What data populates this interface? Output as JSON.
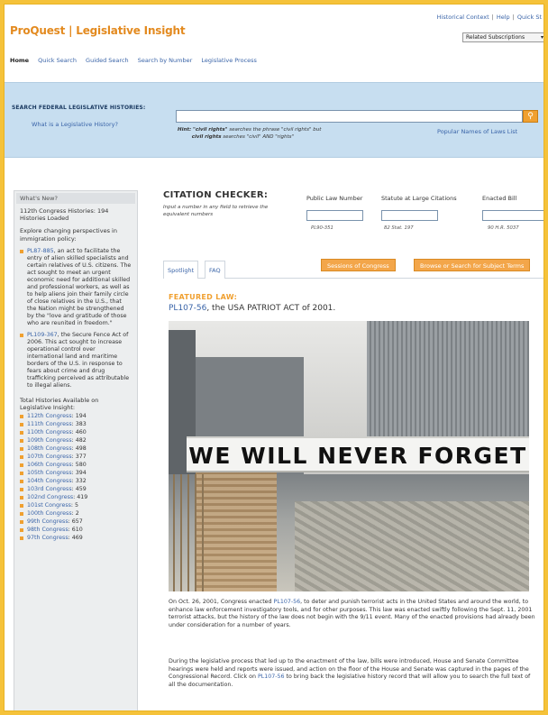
{
  "header": {
    "brand": "ProQuest | Legislative Insight",
    "top_links": [
      "Historical Context",
      "Help",
      "Quick St"
    ],
    "related_select": "Related Subscriptions"
  },
  "nav": {
    "items": [
      "Home",
      "Quick Search",
      "Guided Search",
      "Search by Number",
      "Legislative Process"
    ]
  },
  "search": {
    "label": "SEARCH FEDERAL LEGISLATIVE HISTORIES:",
    "what_link": "What is a Legislative History?",
    "input_value": "",
    "hint_prefix": "Hint:",
    "hint_phrase1": "\"civil rights\"",
    "hint_text1": "searches the phrase \"civil rights\" but",
    "hint_phrase2": "civil rights",
    "hint_text2": "searches \"civil\" AND \"rights\"",
    "popular_link": "Popular Names of Laws List",
    "button_icon": "search-icon"
  },
  "sidebar": {
    "heading": "What's New?",
    "loaded_text": "112th Congress Histories: 194 Histories Loaded",
    "explore_text": "Explore changing perspectives in immigration policy:",
    "items": [
      {
        "link": "PL87-885",
        "text": ", an act to facilitate the entry of alien skilled specialists and certain relatives of U.S. citizens. The act sought to meet an urgent economic need for additional skilled and professional workers, as well as to help aliens join their family circle of close relatives in the U.S., that the Nation might be strengthened by the \"love and gratitude of those who are reunited in freedom.\""
      },
      {
        "link": "PL109-367",
        "text": ", the Secure Fence Act of 2006. This act sought to increase operational control over international land and maritime borders of the U.S. in response to fears about crime and drug trafficking perceived as attributable to illegal aliens."
      }
    ],
    "total_heading": "Total Histories Available on Legislative Insight:",
    "congresses": [
      {
        "name": "112th Congress",
        "count": "194"
      },
      {
        "name": "111th Congress",
        "count": "383"
      },
      {
        "name": "110th Congress",
        "count": "460"
      },
      {
        "name": "109th Congress",
        "count": "482"
      },
      {
        "name": "108th Congress",
        "count": "498"
      },
      {
        "name": "107th Congress",
        "count": "377"
      },
      {
        "name": "106th Congress",
        "count": "580"
      },
      {
        "name": "105th Congress",
        "count": "394"
      },
      {
        "name": "104th Congress",
        "count": "332"
      },
      {
        "name": "103rd Congress",
        "count": "459"
      },
      {
        "name": "102nd Congress",
        "count": "419"
      },
      {
        "name": "101st Congress",
        "count": "5"
      },
      {
        "name": "100th Congress",
        "count": "2"
      },
      {
        "name": "99th Congress",
        "count": "657"
      },
      {
        "name": "98th Congress",
        "count": "610"
      },
      {
        "name": "97th Congress",
        "count": "469"
      }
    ]
  },
  "citation": {
    "title": "CITATION CHECKER:",
    "desc": "Input a number in any field to retrieve the equivalent numbers",
    "columns": [
      {
        "label": "Public Law Number",
        "example": "PL90-351"
      },
      {
        "label": "Statute at Large Citations",
        "example": "82 Stat. 197"
      },
      {
        "label": "Enacted Bill",
        "example": "90 H.R. 5037"
      }
    ]
  },
  "tabs": {
    "spotlight": "Spotlight",
    "faq": "FAQ",
    "sessions": "Sessions of Congress",
    "browse": "Browse or Search for Subject Terms"
  },
  "featured": {
    "label": "FEATURED LAW:",
    "law_link": "PL107-56",
    "law_title": ", the USA PATRIOT ACT of 2001.",
    "banner_text": "WE WILL NEVER FORGET",
    "para1_a": "On Oct. 26, 2001, Congress enacted ",
    "para1_link": "PL107-56",
    "para1_b": ", to deter and punish terrorist acts in the United States and around the world, to enhance law enforcement investigatory tools, and for other purposes. This law was enacted swiftly following the Sept. 11, 2001 terrorist attacks, but the history of the law does not begin with the 9/11 event. Many of the enacted provisions had already been under consideration for a number of years.",
    "para2_a": "During the legislative process that led up to the enactment of the law, bills were introduced, House and Senate Committee hearings were held and reports were issued, and action on the floor of the House and Senate was captured in the pages of the Congressional Record. Click on ",
    "para2_link": "PL107-56",
    "para2_b": " to bring back the legislative history record that will allow you to search the full text of all the documentation."
  }
}
